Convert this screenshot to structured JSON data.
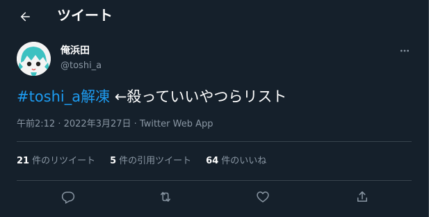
{
  "header": {
    "title": "ツイート",
    "back_icon": "back-arrow-icon"
  },
  "tweet": {
    "author": {
      "display_name": "俺浜田",
      "handle": "@toshi_a"
    },
    "text": {
      "hashtag": "#toshi_a解凍",
      "body": " ←殺っていいやつらリスト"
    },
    "meta": {
      "time": "午前2:12",
      "separator": " · ",
      "date": "2022年3月27日",
      "source": "Twitter Web App"
    },
    "stats": [
      {
        "count": "21",
        "label": "件のリツイート"
      },
      {
        "count": "5",
        "label": "件の引用ツイート"
      },
      {
        "count": "64",
        "label": "件のいいね"
      }
    ],
    "actions": [
      "reply-icon",
      "retweet-icon",
      "like-icon",
      "share-icon"
    ]
  },
  "colors": {
    "background": "#15202b",
    "text_primary": "#ffffff",
    "text_secondary": "#8b98a5",
    "accent": "#1d9bf0",
    "border": "#38444d"
  }
}
